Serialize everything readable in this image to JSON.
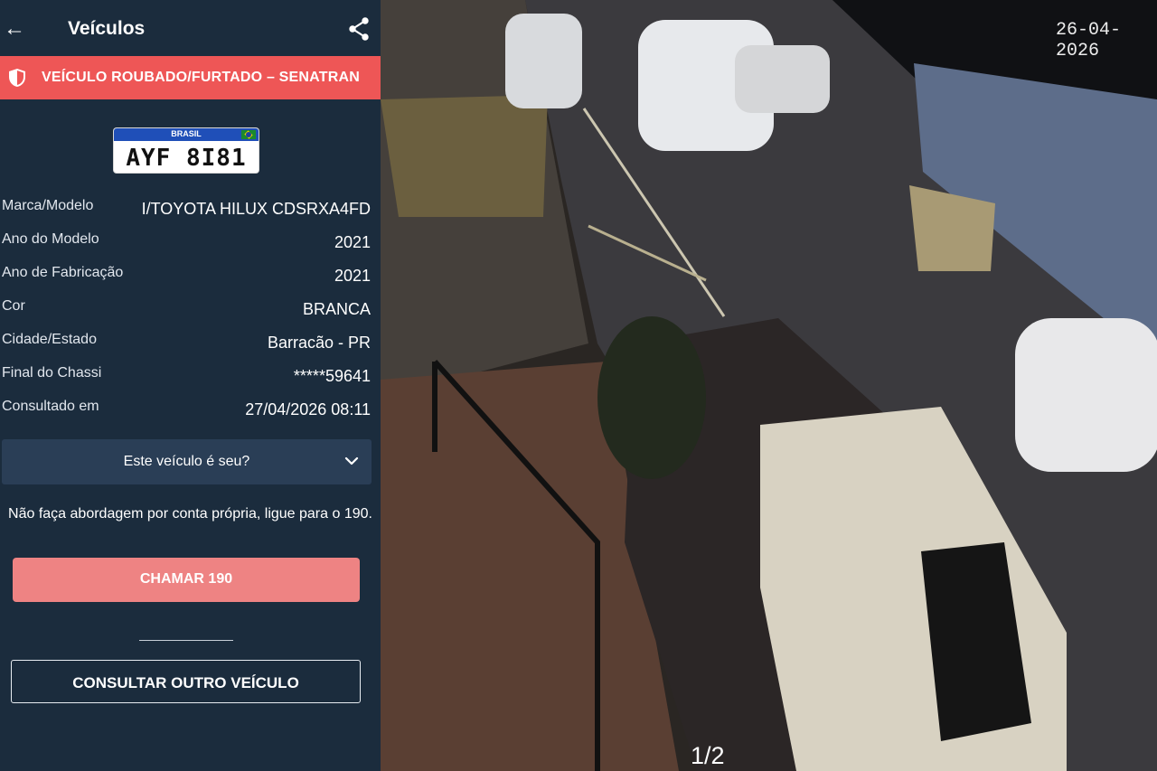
{
  "header": {
    "title": "Veículos"
  },
  "alert": {
    "text": "VEÍCULO ROUBADO/FURTADO – SENATRAN"
  },
  "plate": {
    "country": "BRASIL",
    "number": "AYF 8I81"
  },
  "details": [
    {
      "label": "Marca/Modelo",
      "value": "I/TOYOTA HILUX CDSRXA4FD"
    },
    {
      "label": "Ano do Modelo",
      "value": "2021"
    },
    {
      "label": "Ano de Fabricação",
      "value": "2021"
    },
    {
      "label": "Cor",
      "value": "BRANCA"
    },
    {
      "label": "Cidade/Estado",
      "value": "Barracão - PR"
    },
    {
      "label": "Final do Chassi",
      "value": "*****59641"
    },
    {
      "label": "Consultado em",
      "value": "27/04/2026 08:11"
    }
  ],
  "ownership": {
    "label": "Este veículo é seu?"
  },
  "warning": {
    "text": "Não faça abordagem por conta própria, ligue para o 190."
  },
  "buttons": {
    "call": "CHAMAR 190",
    "other": "CONSULTAR OUTRO VEÍCULO"
  },
  "camera": {
    "timestamp": "26-04-2026",
    "pagination": "1/2"
  },
  "colors": {
    "accent": "#ee5656",
    "background": "#1b2c3d",
    "call_button": "#ee8383",
    "dropdown": "#2a3e56"
  },
  "icons": {
    "back": "arrow-left-icon",
    "share": "share-icon",
    "alert": "shield-icon",
    "dropdown": "chevron-down-icon"
  }
}
